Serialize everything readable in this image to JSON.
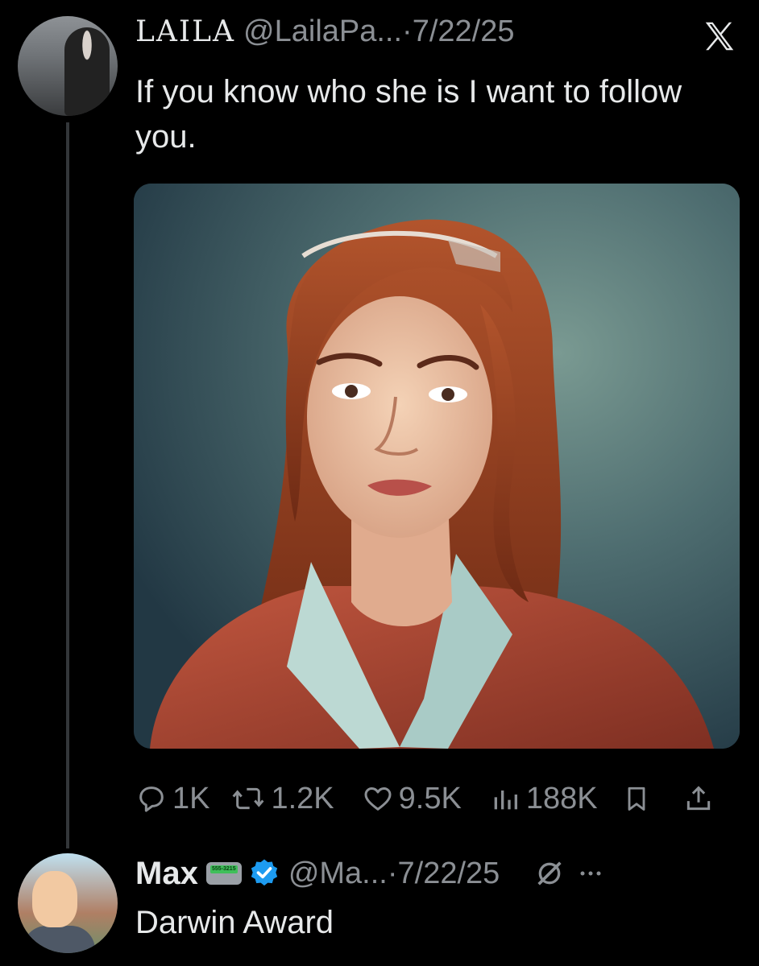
{
  "tweet": {
    "author_name": "LAILA",
    "handle_date": "@LailaPa...·7/22/25",
    "text": "If you know who she is I want to follow you.",
    "stats": {
      "replies": "1K",
      "reposts": "1.2K",
      "likes": "9.5K",
      "views": "188K"
    }
  },
  "reply": {
    "author_name": "Max",
    "pager_text": "555-3215",
    "handle_date": "@Ma...·7/22/25",
    "text": "Darwin Award"
  },
  "colors": {
    "background": "#000000",
    "text": "#e7e9ea",
    "muted": "#8b8f94",
    "verified": "#1d9bf0"
  }
}
